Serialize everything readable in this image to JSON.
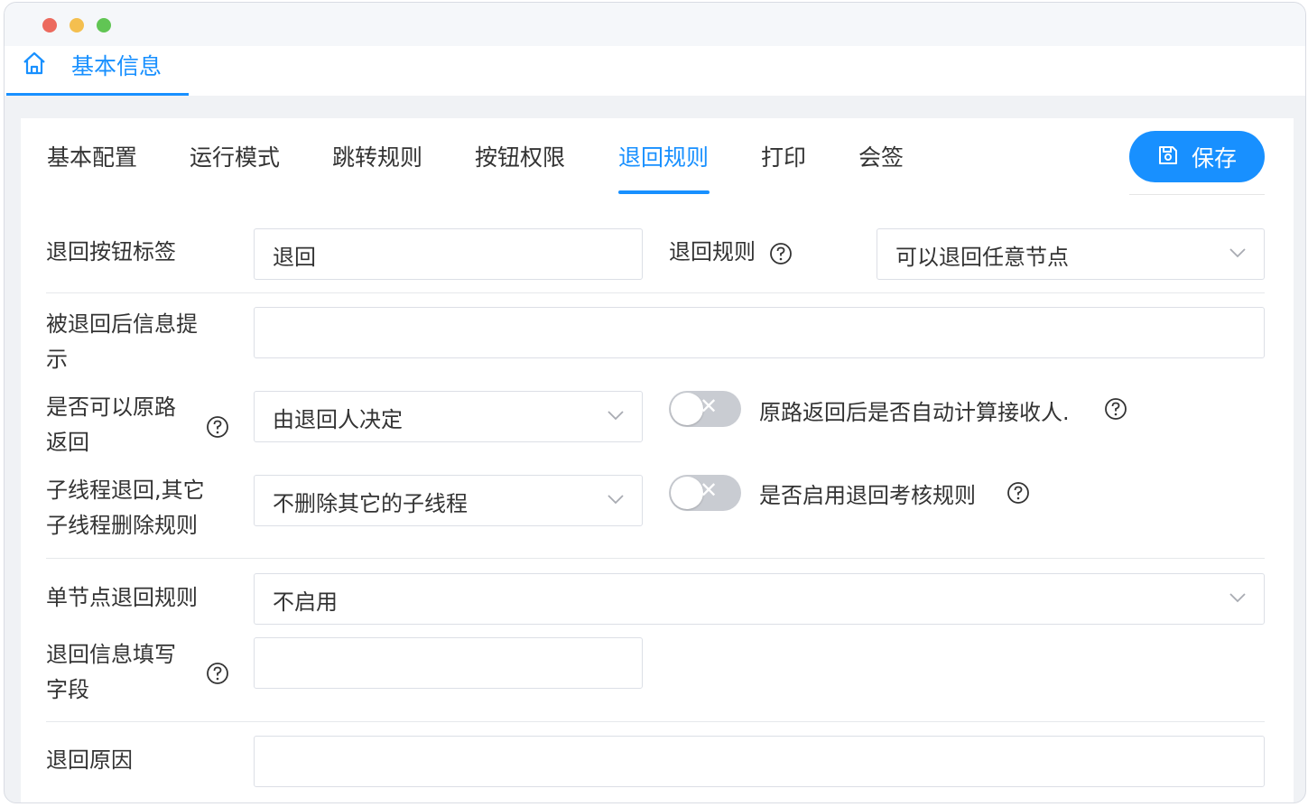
{
  "window": {
    "tab_label": "基本信息"
  },
  "tabs": [
    {
      "label": "基本配置"
    },
    {
      "label": "运行模式"
    },
    {
      "label": "跳转规则"
    },
    {
      "label": "按钮权限"
    },
    {
      "label": "退回规则",
      "active": true
    },
    {
      "label": "打印"
    },
    {
      "label": "会签"
    }
  ],
  "toolbar": {
    "save_label": "保存"
  },
  "form": {
    "return_button_label": {
      "label": "退回按钮标签",
      "value": "退回"
    },
    "return_rule": {
      "label": "退回规则",
      "value": "可以退回任意节点"
    },
    "returned_message": {
      "label_line1": "被退回后信息提",
      "label_line2": "示",
      "value": ""
    },
    "original_route_return": {
      "label_line1": "是否可以原路",
      "label_line2": "返回",
      "value": "由退回人决定"
    },
    "auto_calc_receiver": {
      "label": "原路返回后是否自动计算接收人.",
      "enabled": false
    },
    "subthread_delete": {
      "label_line1": "子线程退回,其它",
      "label_line2": "子线程删除规则",
      "value": "不删除其它的子线程"
    },
    "enable_assessment": {
      "label": "是否启用退回考核规则",
      "enabled": false
    },
    "single_node_rule": {
      "label": "单节点退回规则",
      "value": "不启用"
    },
    "return_info_field": {
      "label_line1": "退回信息填写",
      "label_line2": "字段",
      "value": ""
    },
    "return_reason": {
      "label": "退回原因",
      "value": ""
    }
  },
  "colors": {
    "accent": "#1890ff",
    "toggle_off": "#c9ccd2"
  },
  "icons": {
    "home": "home-icon",
    "save": "save-icon",
    "help": "help-icon",
    "dropdown": "chevron-down-icon"
  }
}
